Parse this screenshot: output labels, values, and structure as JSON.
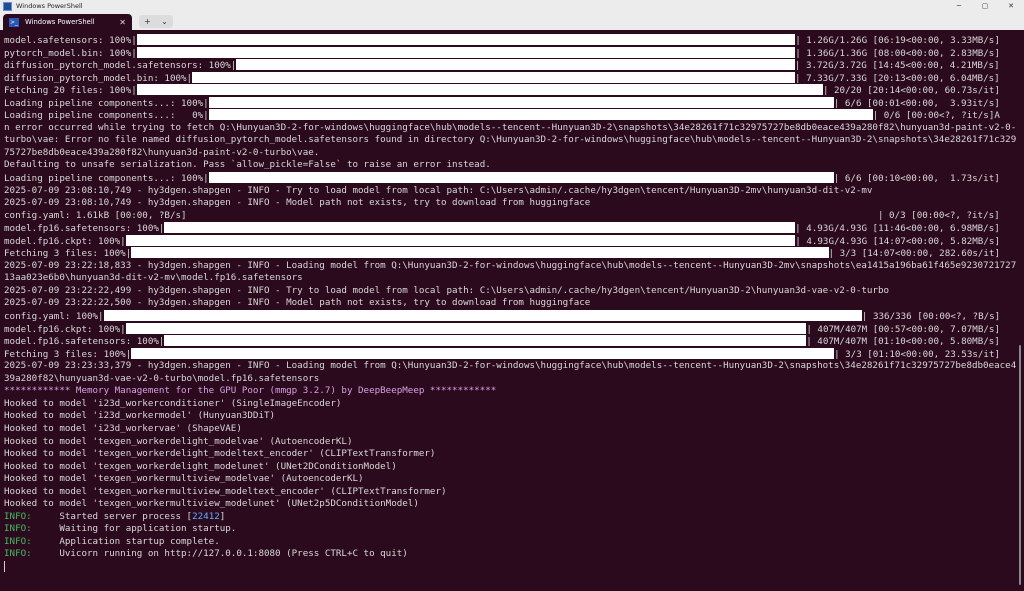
{
  "window": {
    "title": "Windows PowerShell",
    "tab_label": "Windows PowerShell",
    "tab_icon": "powershell-icon",
    "minimize": "─",
    "maximize": "▢",
    "close": "✕",
    "tab_close": "✕",
    "new_tab": "+",
    "dropdown": "⌄"
  },
  "lines": [
    {
      "pre": "model.safetensors: 100%|",
      "post": "| 1.26G/1.26G [06:19<00:00, 3.33MB/s]"
    },
    {
      "pre": "pytorch_model.bin: 100%|",
      "post": "| 1.36G/1.36G [08:00<00:00, 2.83MB/s]"
    },
    {
      "pre": "diffusion_pytorch_model.safetensors: 100%|",
      "post": "| 3.72G/3.72G [14:45<00:00, 4.21MB/s]"
    },
    {
      "pre": "diffusion_pytorch_model.bin: 100%|",
      "post": "| 7.33G/7.33G [20:13<00:00, 6.04MB/s]"
    },
    {
      "pre": "Fetching 20 files: 100%|",
      "post": "| 20/20 [20:14<00:00, 60.73s/it]"
    },
    {
      "pre": "Loading pipeline components...: 100%|",
      "post": "| 6/6 [00:01<00:00,  3.93it/s]"
    },
    {
      "pre": "Loading pipeline components...:   0%|",
      "post": "| 0/6 [00:00<?, ?it/s]A"
    },
    {
      "text": "n error occurred while trying to fetch Q:\\Hunyuan3D-2-for-windows\\huggingface\\hub\\models--tencent--Hunyuan3D-2\\snapshots\\34e28261f71c32975727be8db0eace439a280f82\\hunyuan3d-paint-v2-0-"
    },
    {
      "text": "turbo\\vae: Error no file named diffusion_pytorch_model.safetensors found in directory Q:\\Hunyuan3D-2-for-windows\\huggingface\\hub\\models--tencent--Hunyuan3D-2\\snapshots\\34e28261f71c329"
    },
    {
      "text": "75727be8db0eace439a280f82\\hunyuan3d-paint-v2-0-turbo\\vae."
    },
    {
      "text": "Defaulting to unsafe serialization. Pass `allow_pickle=False` to raise an error instead."
    },
    {
      "pre": "Loading pipeline components...: 100%|",
      "post": "| 6/6 [00:10<00:00,  1.73s/it]"
    },
    {
      "text": "2025-07-09 23:08:10,749 - hy3dgen.shapgen - INFO - Try to load model from local path: C:\\Users\\admin/.cache/hy3dgen\\tencent/Hunyuan3D-2mv\\hunyuan3d-dit-v2-mv"
    },
    {
      "text": "2025-07-09 23:08:10,749 - hy3dgen.shapgen - INFO - Model path not exists, try to download from huggingface"
    },
    {
      "text": "config.yaml: 1.61kB [00:00, ?B/s]",
      "post2": "| 0/3 [00:00<?, ?it/s]"
    },
    {
      "pre": "model.fp16.safetensors: 100%|",
      "post": "| 4.93G/4.93G [11:46<00:00, 6.98MB/s]"
    },
    {
      "pre": "model.fp16.ckpt: 100%|",
      "post": "| 4.93G/4.93G [14:07<00:00, 5.82MB/s]"
    },
    {
      "pre": "Fetching 3 files: 100%|",
      "post": "| 3/3 [14:07<00:00, 282.60s/it]"
    },
    {
      "text": "2025-07-09 23:22:18,833 - hy3dgen.shapgen - INFO - Loading model from Q:\\Hunyuan3D-2-for-windows\\huggingface\\hub\\models--tencent--Hunyuan3D-2mv\\snapshots\\ea1415a196ba61f465e9230721727"
    },
    {
      "text": "13aa023e6b0\\hunyuan3d-dit-v2-mv\\model.fp16.safetensors"
    },
    {
      "text": "2025-07-09 23:22:22,499 - hy3dgen.shapgen - INFO - Try to load model from local path: C:\\Users\\admin/.cache/hy3dgen\\tencent/Hunyuan3D-2\\hunyuan3d-vae-v2-0-turbo"
    },
    {
      "text": "2025-07-09 23:22:22,500 - hy3dgen.shapgen - INFO - Model path not exists, try to download from huggingface"
    },
    {
      "pre": "config.yaml: 100%|",
      "post": "| 336/336 [00:00<?, ?B/s]"
    },
    {
      "pre": "model.fp16.ckpt: 100%|",
      "post": "| 407M/407M [00:57<00:00, 7.07MB/s]"
    },
    {
      "pre": "model.fp16.safetensors: 100%|",
      "post": "| 407M/407M [01:10<00:00, 5.80MB/s]"
    },
    {
      "pre": "Fetching 3 files: 100%|",
      "post": "| 3/3 [01:10<00:00, 23.53s/it]"
    },
    {
      "text": "2025-07-09 23:23:33,379 - hy3dgen.shapgen - INFO - Loading model from Q:\\Hunyuan3D-2-for-windows\\huggingface\\hub\\models--tencent--Hunyuan3D-2\\snapshots\\34e28261f71c32975727be8db0eace4"
    },
    {
      "text": "39a280f82\\hunyuan3d-vae-v2-0-turbo\\model.fp16.safetensors"
    },
    {
      "mem": "************ Memory Management for the GPU Poor (mmgp 3.2.7) by DeepBeepMeep ************"
    },
    {
      "text": "Hooked to model 'i23d_workerconditioner' (SingleImageEncoder)"
    },
    {
      "text": "Hooked to model 'i23d_workermodel' (Hunyuan3DDiT)"
    },
    {
      "text": "Hooked to model 'i23d_workervae' (ShapeVAE)"
    },
    {
      "text": "Hooked to model 'texgen_workerdelight_modelvae' (AutoencoderKL)"
    },
    {
      "text": "Hooked to model 'texgen_workerdelight_modeltext_encoder' (CLIPTextTransformer)"
    },
    {
      "text": "Hooked to model 'texgen_workerdelight_modelunet' (UNet2DConditionModel)"
    },
    {
      "text": "Hooked to model 'texgen_workermultiview_modelvae' (AutoencoderKL)"
    },
    {
      "text": "Hooked to model 'texgen_workermultiview_modeltext_encoder' (CLIPTextTransformer)"
    },
    {
      "text": "Hooked to model 'texgen_workermultiview_modelunet' (UNet2p5DConditionModel)"
    },
    {
      "info": "INFO:",
      "msg": "     Started server process [",
      "pid": "22412",
      "tail": "]"
    },
    {
      "info": "INFO:",
      "msg": "     Waiting for application startup."
    },
    {
      "info": "INFO:",
      "msg": "     Application startup complete."
    },
    {
      "info": "INFO:",
      "msg": "     Uvicorn running on http://127.0.0.1:8080 (Press CTRL+C to quit)"
    }
  ]
}
